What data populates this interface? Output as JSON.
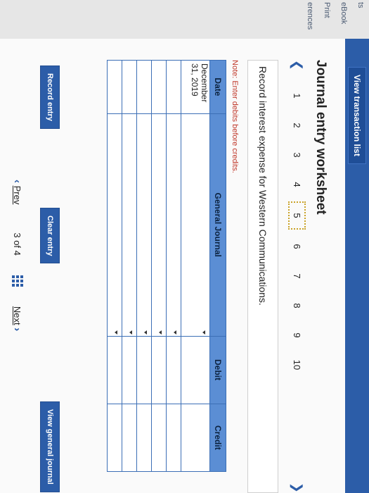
{
  "sidebar": {
    "items": [
      "ts",
      "eBook",
      "Print",
      "erences"
    ]
  },
  "topbar": {
    "view_list": "View transaction list"
  },
  "worksheet": {
    "title": "Journal entry worksheet",
    "pages": [
      "1",
      "2",
      "3",
      "4",
      "5",
      "6",
      "7",
      "8",
      "9",
      "10"
    ],
    "active_page": "5",
    "prev_icon": "chevron-left-icon",
    "next_icon": "chevron-right-icon",
    "instruction": "Record interest expense for Western Communications.",
    "note": "Note: Enter debits before credits."
  },
  "table": {
    "headers": [
      "Date",
      "General Journal",
      "Debit",
      "Credit"
    ],
    "first_date": "December 31, 2019"
  },
  "buttons": {
    "record": "Record entry",
    "clear": "Clear entry",
    "view_journal": "View general journal"
  },
  "footer": {
    "prev": "Prev",
    "page_status": "3 of 4",
    "next": "Next"
  },
  "colors": {
    "accent": "#2c5da8",
    "header": "#5b8ed4",
    "note": "#c0392b"
  }
}
